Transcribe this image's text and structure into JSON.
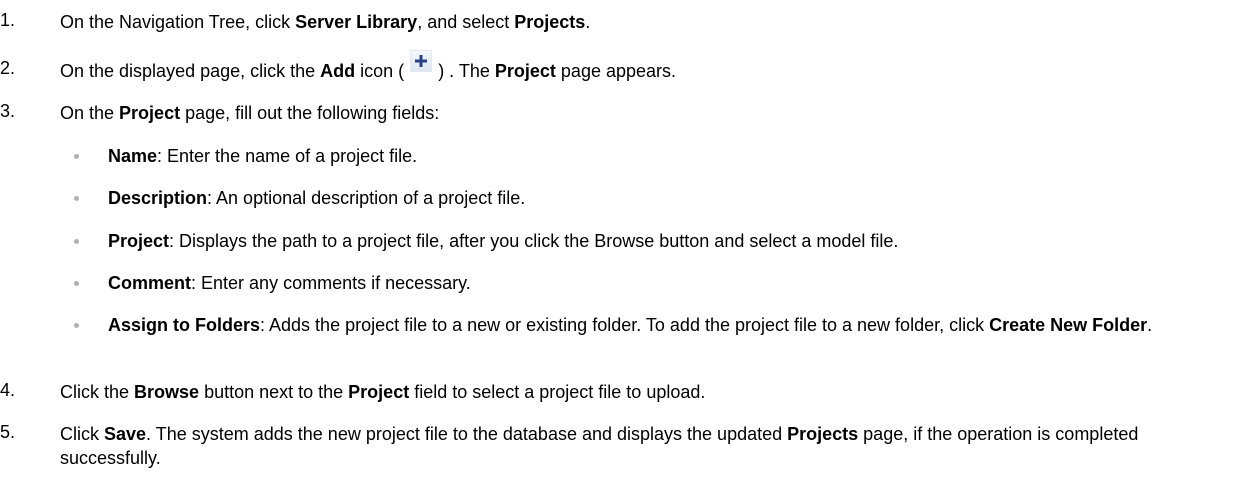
{
  "steps": [
    {
      "num": "1.",
      "t1": "On the Navigation Tree, click ",
      "b1": "Server Library",
      "t2": ", and select ",
      "b2": "Projects",
      "t3": "."
    },
    {
      "num": "2.",
      "t1": "On the displayed page, click the ",
      "b1": "Add",
      "t2": " icon (",
      "t3": ") . The ",
      "b2": "Project",
      "t4": " page appears."
    },
    {
      "num": "3.",
      "t1": "On the ",
      "b1": "Project",
      "t2": " page, fill out the following fields:"
    },
    {
      "num": "4.",
      "t1": "Click the ",
      "b1": "Browse",
      "t2": " button next to the ",
      "b2": "Project",
      "t3": " field to select a project file to upload."
    },
    {
      "num": "5.",
      "t1": "Click ",
      "b1": "Save",
      "t2": ". The system adds the new project file to the database and displays the updated ",
      "b2": "Projects",
      "t3": " page, if the operation is completed successfully."
    }
  ],
  "fields": [
    {
      "name": "Name",
      "desc": ": Enter the name of a project file."
    },
    {
      "name": "Description",
      "desc": ": An optional description of a project file."
    },
    {
      "name": "Project",
      "desc": ": Displays the path to a project file, after you click the Browse button and select a model file."
    },
    {
      "name": "Comment",
      "desc": ": Enter any comments if necessary."
    },
    {
      "name": "Assign to Folders",
      "desc": ": Adds the project file to a new or existing folder. To add the project file to a new folder, click ",
      "link": "Create New Folder",
      "end": "."
    }
  ],
  "icons": {
    "add": "add-icon"
  }
}
